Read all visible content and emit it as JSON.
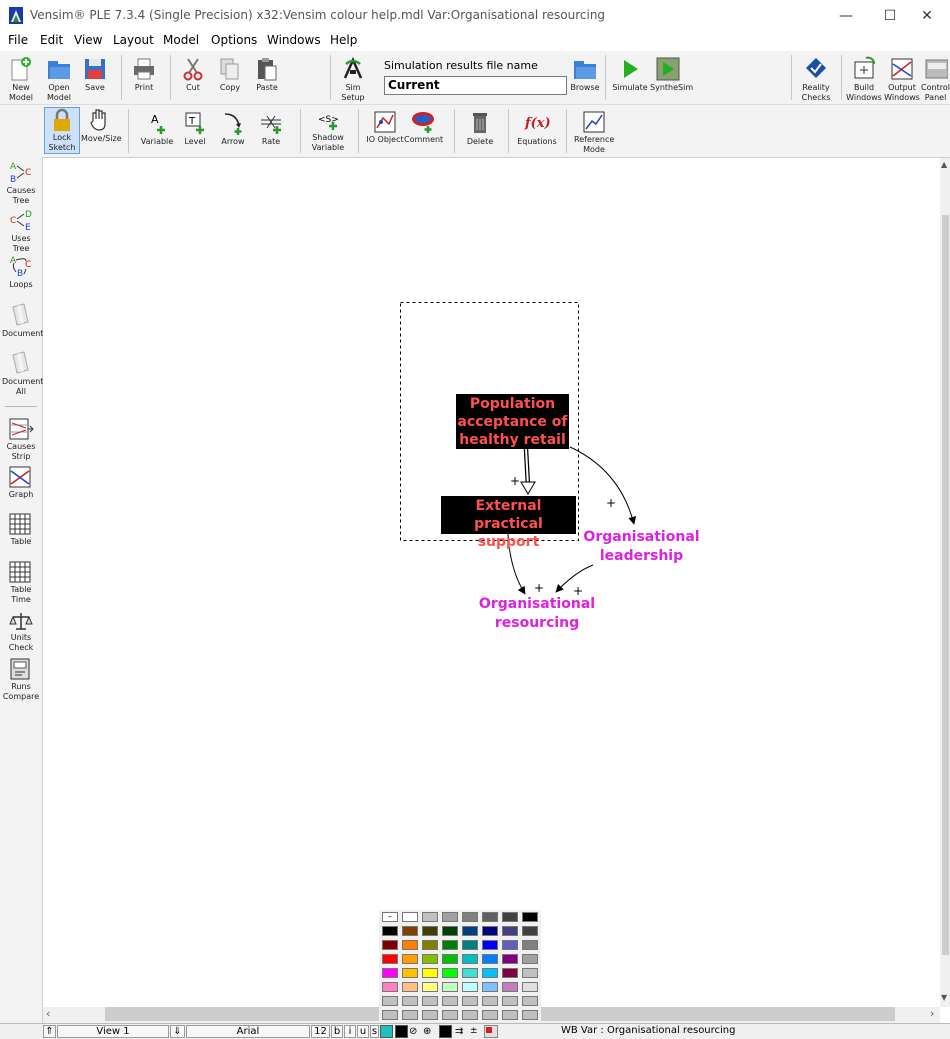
{
  "window": {
    "title": "Vensim® PLE 7.3.4 (Single Precision) x32:Vensim colour help.mdl Var:Organisational resourcing",
    "controls": {
      "minimize": "—",
      "maximize": "☐",
      "close": "✕"
    }
  },
  "menu": [
    "File",
    "Edit",
    "View",
    "Layout",
    "Model",
    "Options",
    "Windows",
    "Help"
  ],
  "toolbar1": {
    "new_model": "New Model",
    "open_model": "Open Model",
    "save": "Save",
    "print": "Print",
    "cut": "Cut",
    "copy": "Copy",
    "paste": "Paste",
    "sim_setup": "Sim Setup",
    "sim_results_label": "Simulation results file name",
    "sim_results_value": "Current",
    "browse": "Browse",
    "simulate": "Simulate",
    "synthesim": "SyntheSim",
    "reality_checks": "Reality Checks",
    "build_windows": "Build Windows",
    "output_windows": "Output Windows",
    "control_panel": "Control Panel"
  },
  "toolbar2": {
    "lock_sketch": "Lock Sketch",
    "move_size": "Move/Size",
    "variable": "Variable",
    "level": "Level",
    "arrow": "Arrow",
    "rate": "Rate",
    "shadow_variable": "Shadow Variable",
    "io_object": "IO Object",
    "comment": "Comment",
    "delete": "Delete",
    "equations": "Equations",
    "reference_mode": "Reference Mode"
  },
  "leftbar": {
    "causes_tree": "Causes Tree",
    "uses_tree": "Uses Tree",
    "loops": "Loops",
    "document": "Document",
    "document_all": "Document All",
    "causes_strip": "Causes Strip",
    "graph": "Graph",
    "table": "Table",
    "table_time": "Table Time",
    "units_check": "Units Check",
    "runs_compare": "Runs Compare"
  },
  "diagram": {
    "nodes": {
      "population": "Population acceptance of healthy retail",
      "external": "External practical support",
      "leadership": "Organisational leadership",
      "resourcing": "Organisational resourcing"
    },
    "polarities": [
      "+",
      "+",
      "+",
      "+"
    ],
    "colors": {
      "node_bg": "#000000",
      "node_text": "#ff4f4f",
      "magenta": "#e020e0"
    }
  },
  "palette": {
    "rows": [
      [
        "#ffffff",
        "#ffffff",
        "#c0c0c0",
        "#a0a0a0",
        "#808080",
        "#606060",
        "#404040",
        "#000000"
      ],
      [
        "#000000",
        "#804000",
        "#404000",
        "#004000",
        "#004080",
        "#000080",
        "#404080",
        "#404040"
      ],
      [
        "#800000",
        "#ff8000",
        "#808000",
        "#008000",
        "#008080",
        "#0000ff",
        "#6060c0",
        "#808080"
      ],
      [
        "#ff0000",
        "#ffa000",
        "#80c000",
        "#00c000",
        "#00c0c0",
        "#0080ff",
        "#800080",
        "#a0a0a0"
      ],
      [
        "#ff00ff",
        "#ffc000",
        "#ffff00",
        "#00ff00",
        "#40e0d0",
        "#00c0ff",
        "#800040",
        "#c0c0c0"
      ],
      [
        "#ff80c0",
        "#ffc080",
        "#ffff80",
        "#c0ffc0",
        "#c0ffff",
        "#80c0ff",
        "#c080c0",
        "#e0e0e0"
      ],
      [
        "#c0c0c0",
        "#c0c0c0",
        "#c0c0c0",
        "#c0c0c0",
        "#c0c0c0",
        "#c0c0c0",
        "#c0c0c0",
        "#c0c0c0"
      ],
      [
        "#c0c0c0",
        "#c0c0c0",
        "#c0c0c0",
        "#c0c0c0",
        "#c0c0c0",
        "#c0c0c0",
        "#c0c0c0",
        "#c0c0c0"
      ]
    ],
    "none_label": "–"
  },
  "statusbar": {
    "view": "View 1",
    "font": "Arial",
    "size": "12",
    "bold": "b",
    "italic": "i",
    "underline": "u",
    "strike": "s",
    "info": "WB Var : Organisational resourcing"
  }
}
